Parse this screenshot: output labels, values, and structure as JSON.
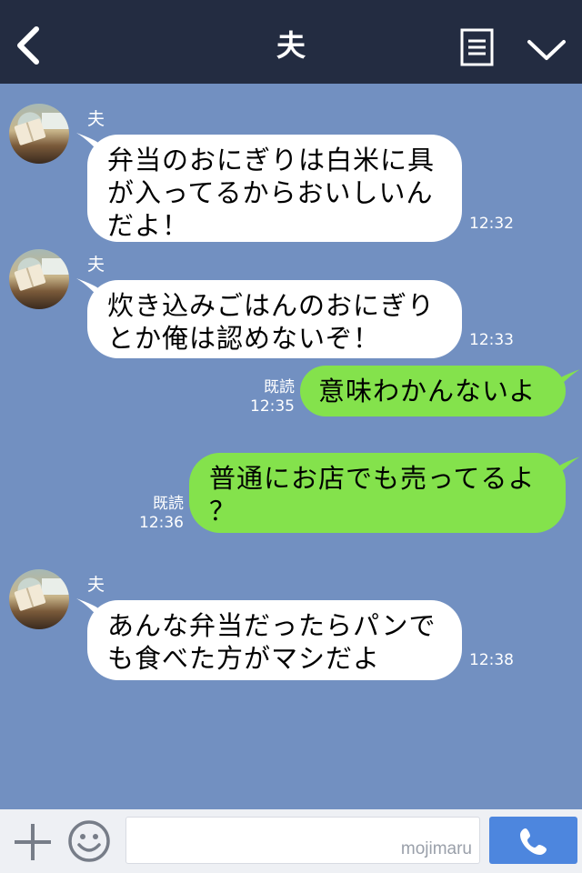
{
  "header": {
    "title": "夫",
    "back_icon": "chevron-left-icon",
    "menu_icon": "note-icon",
    "expand_icon": "chevron-down-icon"
  },
  "messages": [
    {
      "from": "them",
      "sender": "夫",
      "text": "弁当のおにぎりは白米に具\nが入ってるからおいしいん\nだよ！",
      "time": "12:32"
    },
    {
      "from": "them",
      "sender": "夫",
      "text": "炊き込みごはんのおにぎり\nとか俺は認めないぞ！",
      "time": "12:33"
    },
    {
      "from": "me",
      "read": "既読",
      "text": "意味わかんないよ",
      "time": "12:35"
    },
    {
      "from": "me",
      "read": "既読",
      "text": "普通にお店でも売ってるよ\n？",
      "time": "12:36"
    },
    {
      "from": "them",
      "sender": "夫",
      "text": "あんな弁当だったらパンで\nも食べた方がマシだよ",
      "time": "12:38"
    }
  ],
  "footer": {
    "plus_icon": "plus-icon",
    "emoji_icon": "smiley-icon",
    "input_value": "",
    "watermark": "mojimaru",
    "send_icon": "phone-icon"
  },
  "colors": {
    "header_bg": "#232c41",
    "chat_bg": "#7290c1",
    "outgoing_bubble": "#84e24c",
    "incoming_bubble": "#ffffff",
    "send_button": "#4d86de"
  }
}
